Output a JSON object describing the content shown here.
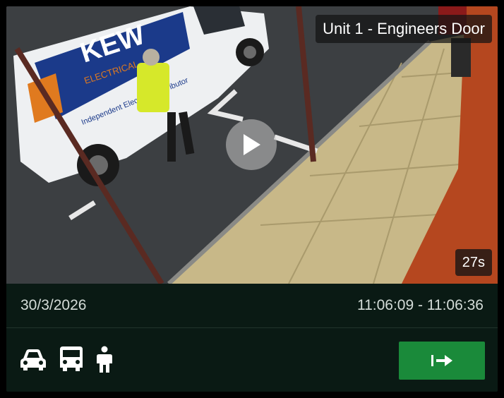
{
  "camera": {
    "title": "Unit 1 - Engineers Door",
    "duration": "27s"
  },
  "event": {
    "date": "30/3/2026",
    "time_range": "11:06:09 - 11:06:36"
  },
  "van_text": {
    "brand": "KEW",
    "subbrand": "ELECTRICAL",
    "tagline": "Independent Electrical Distributor"
  },
  "detections": [
    {
      "icon": "car-icon"
    },
    {
      "icon": "van-icon"
    },
    {
      "icon": "person-icon"
    }
  ],
  "actions": {
    "open_icon": "arrow-right-to-bar-icon"
  },
  "colors": {
    "accent": "#1a8a3a",
    "panel": "#0a1a14",
    "text": "#d4dcd8"
  }
}
